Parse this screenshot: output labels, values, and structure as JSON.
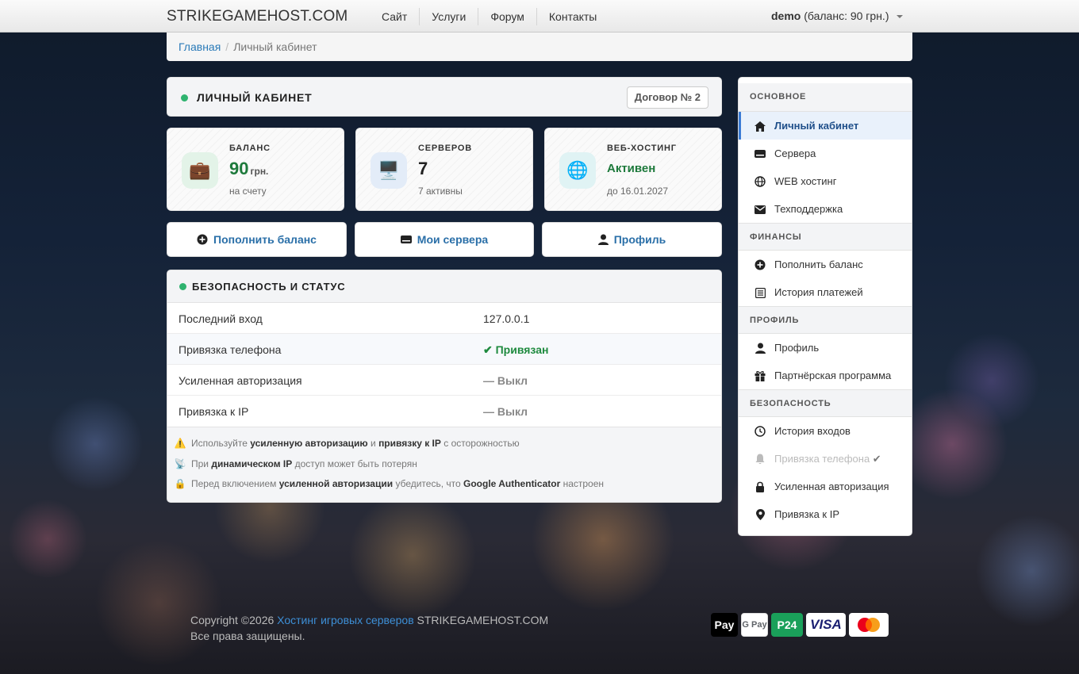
{
  "navbar": {
    "brand": "STRIKEGAMEHOST.COM",
    "links": [
      "Сайт",
      "Услуги",
      "Форум",
      "Контакты"
    ],
    "user": "demo",
    "balance": "(баланс: 90 грн.)"
  },
  "breadcrumb": {
    "home": "Главная",
    "separator": "/",
    "current": "Личный кабинет"
  },
  "header": {
    "title": "ЛИЧНЫЙ КАБИНЕТ",
    "contract": "Договор № 2"
  },
  "stats": [
    {
      "label": "БАЛАНС",
      "value": "90",
      "unit": "грн.",
      "sub": "на счету",
      "icon": "briefcase-icon",
      "color": "#1e7a3c"
    },
    {
      "label": "СЕРВЕРОВ",
      "value": "7",
      "unit": "",
      "sub": "7 активны",
      "icon": "monitor-icon",
      "color": "#222222"
    },
    {
      "label": "ВЕБ-ХОСТИНГ",
      "value": "Активен",
      "unit": "",
      "sub": "до 16.01.2027",
      "icon": "globe-icon",
      "color": "#1e7a3c"
    }
  ],
  "actions": {
    "topup": "Пополнить баланс",
    "servers": "Мои сервера",
    "profile": "Профиль"
  },
  "security": {
    "title": "БЕЗОПАСНОСТЬ И СТАТУС",
    "rows": [
      {
        "key": "Последний вход",
        "value": "127.0.0.1"
      },
      {
        "key": "Привязка телефона",
        "value": "✔ Привязан"
      },
      {
        "key": "Усиленная авторизация",
        "value": "— Выкл"
      },
      {
        "key": "Привязка к IP",
        "value": "— Выкл"
      }
    ],
    "notes": [
      {
        "icon": "warning-icon",
        "parts": [
          "Используйте ",
          "усиленную авторизацию",
          " и ",
          "привязку к IP",
          " с осторожностью"
        ]
      },
      {
        "icon": "antenna-icon",
        "parts": [
          "При ",
          "динамическом IP",
          " доступ может быть потерян"
        ]
      },
      {
        "icon": "lock-icon",
        "parts": [
          "Перед включением ",
          "усиленной авторизации",
          " убедитесь, что ",
          "Google Authenticator",
          " настроен"
        ]
      }
    ]
  },
  "sidebar": {
    "sections": [
      {
        "title": "ОСНОВНОЕ",
        "items": [
          "Личный кабинет",
          "Сервера",
          "WEB хостинг",
          "Техподдержка"
        ]
      },
      {
        "title": "ФИНАНСЫ",
        "items": [
          "Пополнить баланс",
          "История платежей"
        ]
      },
      {
        "title": "ПРОФИЛЬ",
        "items": [
          "Профиль",
          "Партнёрская программа"
        ]
      },
      {
        "title": "БЕЗОПАСНОСТЬ",
        "items": [
          "История входов",
          "Привязка телефона",
          "Усиленная авторизация",
          "Привязка к IP"
        ]
      }
    ]
  },
  "footer": {
    "copyright": "Copyright ©2026",
    "link": "Хостинг игровых серверов",
    "site": "STRIKEGAMEHOST.COM",
    "rights": "Все права защищены.",
    "payments": [
      "Pay",
      "G Pay",
      "P24",
      "VISA",
      "mastercard"
    ]
  }
}
